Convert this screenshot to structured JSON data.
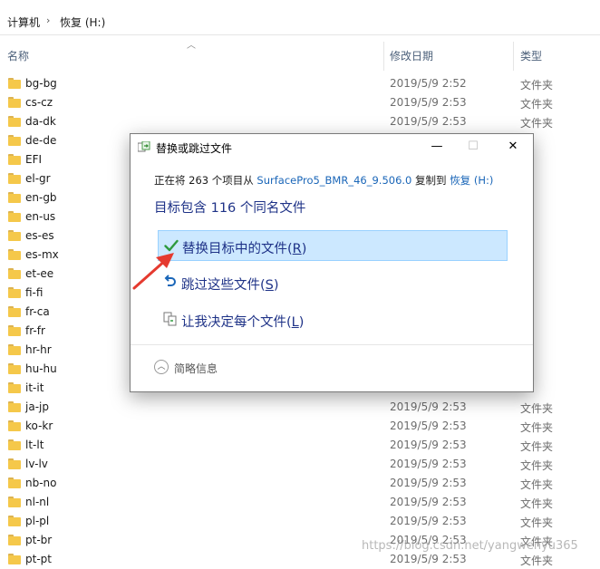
{
  "breadcrumb": {
    "root": "计算机",
    "current": "恢复 (H:)"
  },
  "columns": {
    "name": "名称",
    "date": "修改日期",
    "type": "类型"
  },
  "rows": [
    {
      "name": "bg-bg",
      "date": "2019/5/9 2:52",
      "type": "文件夹"
    },
    {
      "name": "cs-cz",
      "date": "2019/5/9 2:53",
      "type": "文件夹"
    },
    {
      "name": "da-dk",
      "date": "2019/5/9 2:53",
      "type": "文件夹"
    },
    {
      "name": "de-de",
      "date": "",
      "type": ""
    },
    {
      "name": "EFI",
      "date": "",
      "type": ""
    },
    {
      "name": "el-gr",
      "date": "",
      "type": ""
    },
    {
      "name": "en-gb",
      "date": "",
      "type": ""
    },
    {
      "name": "en-us",
      "date": "",
      "type": ""
    },
    {
      "name": "es-es",
      "date": "",
      "type": ""
    },
    {
      "name": "es-mx",
      "date": "",
      "type": ""
    },
    {
      "name": "et-ee",
      "date": "",
      "type": ""
    },
    {
      "name": "fi-fi",
      "date": "",
      "type": ""
    },
    {
      "name": "fr-ca",
      "date": "",
      "type": ""
    },
    {
      "name": "fr-fr",
      "date": "",
      "type": ""
    },
    {
      "name": "hr-hr",
      "date": "",
      "type": ""
    },
    {
      "name": "hu-hu",
      "date": "",
      "type": ""
    },
    {
      "name": "it-it",
      "date": "",
      "type": ""
    },
    {
      "name": "ja-jp",
      "date": "2019/5/9 2:53",
      "type": "文件夹"
    },
    {
      "name": "ko-kr",
      "date": "2019/5/9 2:53",
      "type": "文件夹"
    },
    {
      "name": "lt-lt",
      "date": "2019/5/9 2:53",
      "type": "文件夹"
    },
    {
      "name": "lv-lv",
      "date": "2019/5/9 2:53",
      "type": "文件夹"
    },
    {
      "name": "nb-no",
      "date": "2019/5/9 2:53",
      "type": "文件夹"
    },
    {
      "name": "nl-nl",
      "date": "2019/5/9 2:53",
      "type": "文件夹"
    },
    {
      "name": "pl-pl",
      "date": "2019/5/9 2:53",
      "type": "文件夹"
    },
    {
      "name": "pt-br",
      "date": "2019/5/9 2:53",
      "type": "文件夹"
    },
    {
      "name": "pt-pt",
      "date": "2019/5/9 2:53",
      "type": "文件夹"
    }
  ],
  "dialog": {
    "title": "替换或跳过文件",
    "copy_prefix": "正在将 263 个项目从",
    "source": "SurfacePro5_BMR_46_9.506.0",
    "copy_middle": "复制到",
    "dest": "恢复 (H:)",
    "headline": "目标包含 116 个同名文件",
    "opt_replace": "替换目标中的文件(",
    "opt_replace_key": "R",
    "opt_skip": "跳过这些文件(",
    "opt_skip_key": "S",
    "opt_decide": "让我决定每个文件(",
    "opt_decide_key": "L",
    "close_paren": ")",
    "details": "简略信息",
    "minimize_glyph": "—",
    "maximize_glyph": "☐",
    "close_glyph": "✕",
    "details_glyph": "︿"
  },
  "watermark": "https://blog.csdn.net/yangwenyu365",
  "colors": {
    "accent": "#1a66b8",
    "selection": "#cce8ff",
    "arrow": "#e53a2f",
    "headline": "#1e3287"
  }
}
